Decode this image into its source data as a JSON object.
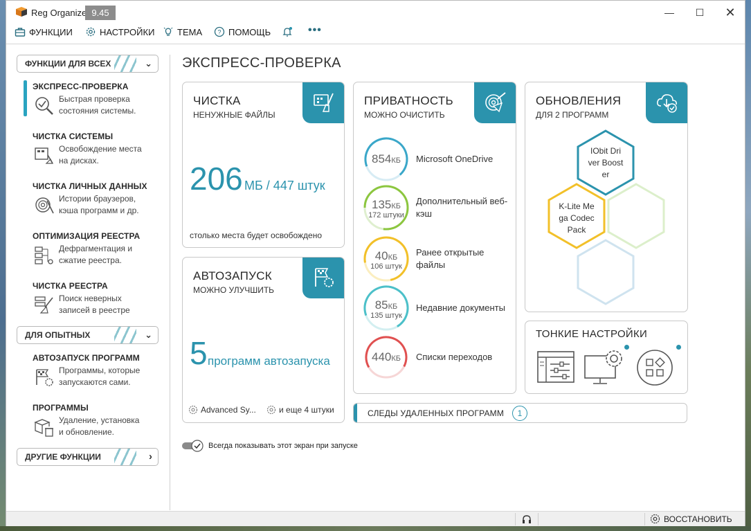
{
  "window": {
    "app_title": "Reg Organizer",
    "version": "9.45",
    "minimize": "—",
    "maximize": "☐",
    "close": "✕"
  },
  "menu": {
    "functions": "ФУНКЦИИ",
    "settings": "НАСТРОЙКИ",
    "theme": "ТЕМА",
    "help": "ПОМОЩЬ",
    "more": "•••"
  },
  "sidebar": {
    "groups": [
      {
        "label": "ФУНКЦИИ ДЛЯ ВСЕХ"
      },
      {
        "label": "ДЛЯ ОПЫТНЫХ"
      },
      {
        "label": "ДРУГИЕ ФУНКЦИИ"
      }
    ],
    "items": [
      {
        "title": "ЭКСПРЕСС-ПРОВЕРКА",
        "desc1": "Быстрая проверка",
        "desc2": "состояния системы."
      },
      {
        "title": "ЧИСТКА СИСТЕМЫ",
        "desc1": "Освобождение места",
        "desc2": "на дисках."
      },
      {
        "title": "ЧИСТКА ЛИЧНЫХ ДАННЫХ",
        "desc1": "Истории браузеров,",
        "desc2": "кэша программ и др."
      },
      {
        "title": "ОПТИМИЗАЦИЯ РЕЕСТРА",
        "desc1": "Дефрагментация и",
        "desc2": "сжатие реестра."
      },
      {
        "title": "ЧИСТКА РЕЕСТРА",
        "desc1": "Поиск неверных",
        "desc2": "записей в реестре"
      },
      {
        "title": "АВТОЗАПУСК ПРОГРАММ",
        "desc1": "Программы, которые",
        "desc2": "запускаются сами."
      },
      {
        "title": "ПРОГРАММЫ",
        "desc1": "Удаление, установка",
        "desc2": "и обновление."
      }
    ]
  },
  "main": {
    "page_title": "ЭКСПРЕСС-ПРОВЕРКА",
    "cleanup": {
      "title": "ЧИСТКА",
      "subtitle": "НЕНУЖНЫЕ ФАЙЛЫ",
      "number": "206",
      "unit": "МБ / 447 штук",
      "footer": "столько места будет освобождено"
    },
    "autorun": {
      "title": "АВТОЗАПУСК",
      "subtitle": "МОЖНО УЛУЧШИТЬ",
      "number": "5",
      "unit": "программ автозапуска",
      "item1": "Advanced Sy...",
      "item2": "и еще 4 штуки"
    },
    "privacy": {
      "title": "ПРИВАТНОСТЬ",
      "subtitle": "МОЖНО ОЧИСТИТЬ",
      "rows": [
        {
          "size": "854",
          "unit": "КБ",
          "count": "",
          "label": "Microsoft OneDrive",
          "color": "#3aa7c9"
        },
        {
          "size": "135",
          "unit": "КБ",
          "count": "172 штуки",
          "label": "Дополнительный веб-кэш",
          "color": "#8cc63f"
        },
        {
          "size": "40",
          "unit": "КБ",
          "count": "106 штук",
          "label": "Ранее открытые файлы",
          "color": "#f2c029"
        },
        {
          "size": "85",
          "unit": "КБ",
          "count": "135 штук",
          "label": "Недавние документы",
          "color": "#4cc0c9"
        },
        {
          "size": "440",
          "unit": "КБ",
          "count": "",
          "label": "Списки переходов",
          "color": "#e05050"
        }
      ]
    },
    "updates": {
      "title": "ОБНОВЛЕНИЯ",
      "subtitle": "ДЛЯ 2 ПРОГРАММ",
      "hex1": [
        "IObit Dri",
        "ver Boost",
        "er"
      ],
      "hex2": [
        "K-Lite Me",
        "ga Codec",
        "Pack"
      ]
    },
    "tuning": {
      "title": "ТОНКИЕ НАСТРОЙКИ"
    },
    "traces": {
      "label": "СЛЕДЫ УДАЛЕННЫХ ПРОГРАММ",
      "count": "1"
    },
    "startup_toggle": {
      "label": "Всегда показывать этот экран при запуске",
      "checked": true
    }
  },
  "status": {
    "restore": "ВОССТАНОВИТЬ"
  },
  "colors": {
    "accent": "#2b93ad"
  }
}
